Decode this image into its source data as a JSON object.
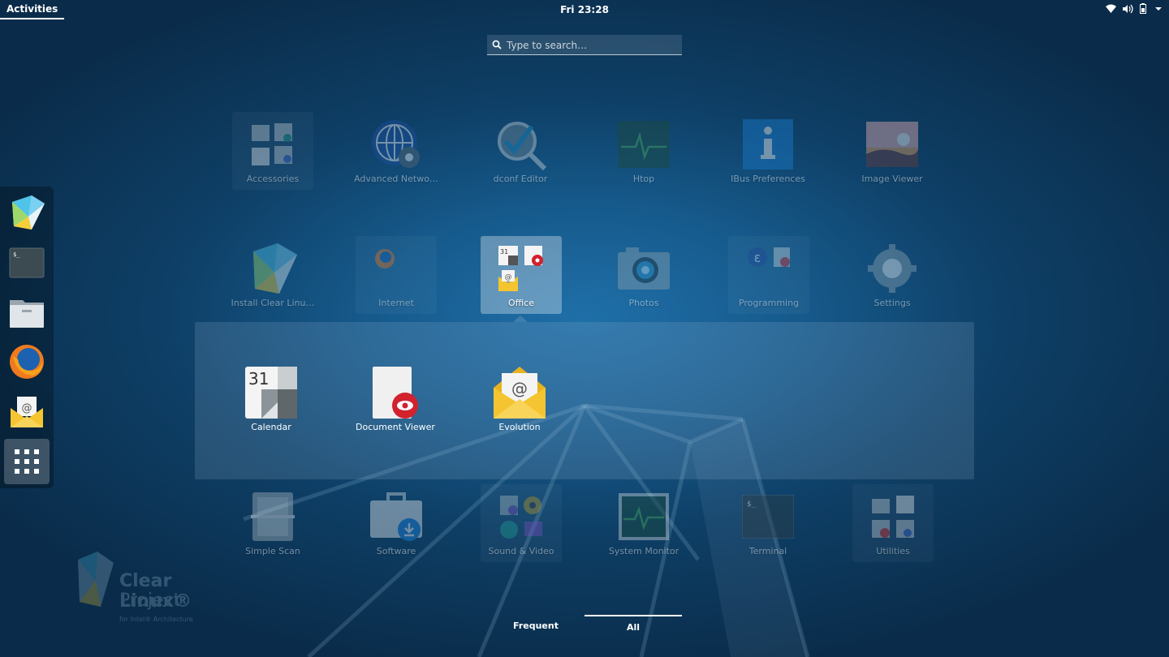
{
  "topbar": {
    "activities_label": "Activities",
    "clock": "Fri 23:28",
    "tray_icons": [
      "wifi-icon",
      "volume-icon",
      "battery-icon",
      "system-menu-arrow-icon"
    ]
  },
  "search": {
    "placeholder": "Type to search…",
    "value": ""
  },
  "dash": {
    "items": [
      {
        "name": "Clear Linux installer",
        "icon": "clear-linux-icon"
      },
      {
        "name": "Terminal",
        "icon": "terminal-icon"
      },
      {
        "name": "Files",
        "icon": "files-icon"
      },
      {
        "name": "Firefox",
        "icon": "firefox-icon"
      },
      {
        "name": "Evolution",
        "icon": "evolution-icon"
      },
      {
        "name": "Show Applications",
        "icon": "app-grid-icon"
      }
    ]
  },
  "grid": {
    "row1": [
      {
        "label": "Accessories",
        "icon": "accessories-folder-icon"
      },
      {
        "label": "Advanced Netwo…",
        "icon": "network-icon"
      },
      {
        "label": "dconf Editor",
        "icon": "dconf-editor-icon"
      },
      {
        "label": "Htop",
        "icon": "htop-icon"
      },
      {
        "label": "IBus Preferences",
        "icon": "ibus-icon"
      },
      {
        "label": "Image Viewer",
        "icon": "image-viewer-icon"
      }
    ],
    "row2": [
      {
        "label": "Install Clear Linu…",
        "icon": "clear-linux-icon"
      },
      {
        "label": "Internet",
        "icon": "internet-folder-icon"
      },
      {
        "label": "Office",
        "icon": "office-folder-icon"
      },
      {
        "label": "Photos",
        "icon": "photos-icon"
      },
      {
        "label": "Programming",
        "icon": "programming-folder-icon"
      },
      {
        "label": "Settings",
        "icon": "settings-icon"
      }
    ],
    "row3": [
      {
        "label": "Simple Scan",
        "icon": "scanner-icon"
      },
      {
        "label": "Software",
        "icon": "software-icon"
      },
      {
        "label": "Sound & Video",
        "icon": "sound-video-folder-icon"
      },
      {
        "label": "System Monitor",
        "icon": "system-monitor-icon"
      },
      {
        "label": "Terminal",
        "icon": "terminal-icon"
      },
      {
        "label": "Utilities",
        "icon": "utilities-folder-icon"
      }
    ]
  },
  "folder_popup": {
    "folder": "Office",
    "apps": [
      {
        "label": "Calendar",
        "icon": "calendar-icon",
        "day": "31"
      },
      {
        "label": "Document Viewer",
        "icon": "document-viewer-icon"
      },
      {
        "label": "Evolution",
        "icon": "evolution-icon"
      }
    ]
  },
  "tabs": {
    "frequent": "Frequent",
    "all": "All",
    "active": "All"
  },
  "watermark": {
    "line1": "Clear Linux®",
    "line2": "Project",
    "line3": "for Intel® Architecture"
  },
  "colors": {
    "background": "#165a8c",
    "evolution_yellow": "#f4c531",
    "docviewer_red": "#d1222e"
  }
}
